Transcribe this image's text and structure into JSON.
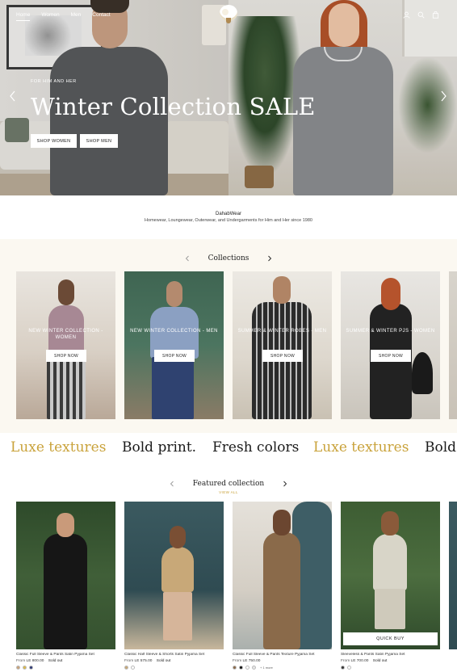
{
  "nav": {
    "links": [
      {
        "label": "Home",
        "active": true
      },
      {
        "label": "Women",
        "active": false
      },
      {
        "label": "Men",
        "active": false
      },
      {
        "label": "Contact",
        "active": false
      }
    ],
    "icons": [
      "account-icon",
      "search-icon",
      "cart-icon"
    ]
  },
  "hero": {
    "kicker": "FOR HIM AND HER",
    "title": "Winter Collection SALE",
    "buttons": [
      {
        "label": "SHOP WOMEN"
      },
      {
        "label": "SHOP MEN"
      }
    ]
  },
  "brand": {
    "name": "DahabWear",
    "tagline": "Homewear, Loungewear, Outerwear, and Undergarments for Him and Her since 1980"
  },
  "collections": {
    "title": "Collections",
    "cards": [
      {
        "label": "NEW WINTER COLLECTION - WOMEN",
        "button": "SHOP NOW"
      },
      {
        "label": "NEW WINTER COLLECTION - MEN",
        "button": "SHOP NOW"
      },
      {
        "label": "SUMMER & WINTER ROBES - MEN",
        "button": "SHOP NOW"
      },
      {
        "label": "SUMMER & WINTER PJS - WOMEN",
        "button": "SHOP NOW"
      }
    ]
  },
  "marquee": {
    "items": [
      "Luxe textures",
      "Bold print.",
      "Fresh colors",
      "Luxe textures",
      "Bold"
    ]
  },
  "featured": {
    "title": "Featured collection",
    "view_all": "VIEW ALL",
    "quick_buy": "QUICK BUY",
    "products": [
      {
        "name": "Classic Full Sleeve & Pants Satin Pyjama Set",
        "from": "From",
        "price": "LE 800.00",
        "status": "Sold out",
        "swatches": [
          "#c9a37a",
          "#d9b84a",
          "#2f3a75"
        ],
        "more": ""
      },
      {
        "name": "Classic Half Sleeve & Shorts Satin Pyjama Set",
        "from": "From",
        "price": "LE 575.00",
        "status": "Sold out",
        "swatches": [
          "#c7a878",
          "#ffffff"
        ],
        "more": ""
      },
      {
        "name": "Classic Full Sleeve & Pants Texture Pyjama Set",
        "from": "From",
        "price": "LE 750.00",
        "status": "",
        "swatches": [
          "#8a6a4a",
          "#111111",
          "#ffffff",
          "#e6e6e6"
        ],
        "more": "+ 1 more"
      },
      {
        "name": "Sleeveless & Pants Satin Pyjama Set",
        "from": "From",
        "price": "LE 700.00",
        "status": "Sold out",
        "swatches": [
          "#333333",
          "#ffffff"
        ],
        "more": ""
      }
    ]
  },
  "colors": {
    "accent_gold": "#c9a23a",
    "collections_bg": "#fbf8f1"
  }
}
